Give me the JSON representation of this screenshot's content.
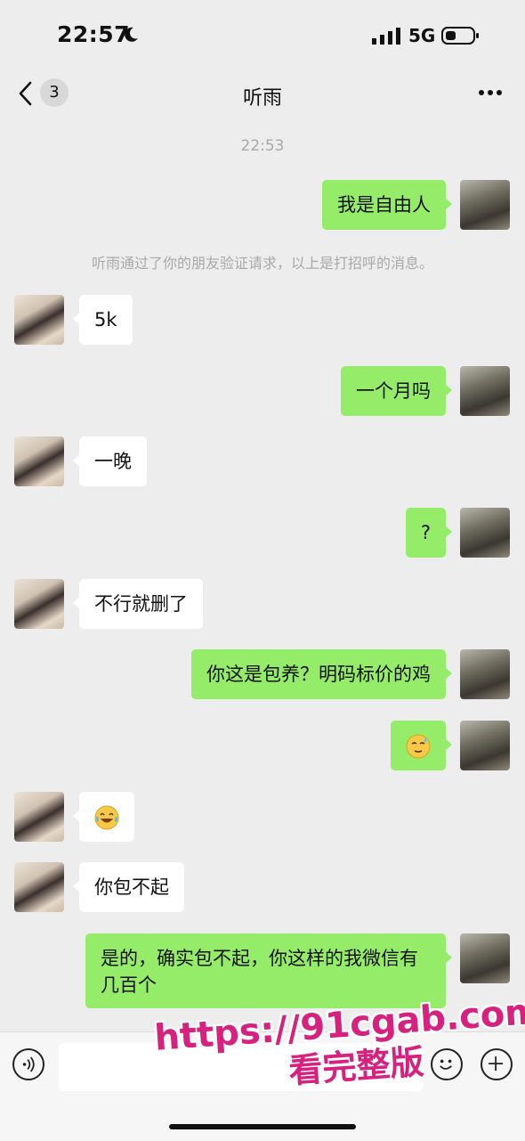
{
  "status_bar": {
    "time": "22:57",
    "network": "5G"
  },
  "header": {
    "back_badge": "3",
    "title": "听雨"
  },
  "timestamp": "22:53",
  "system_notice": "听雨通过了你的朋友验证请求，以上是打招呼的消息。",
  "messages": [
    {
      "from": "me",
      "text": "我是自由人"
    },
    {
      "from": "them",
      "text": "5k"
    },
    {
      "from": "me",
      "text": "一个月吗"
    },
    {
      "from": "them",
      "text": "一晚"
    },
    {
      "from": "me",
      "text": "?"
    },
    {
      "from": "them",
      "text": "不行就删了"
    },
    {
      "from": "me",
      "text": "你这是包养？明码标价的鸡"
    },
    {
      "from": "me",
      "emoji": "sweat-smile-emoji"
    },
    {
      "from": "them",
      "emoji": "tears-of-joy-emoji"
    },
    {
      "from": "them",
      "text": "你包不起"
    },
    {
      "from": "me",
      "text": "是的，确实包不起，你这样的我微信有几百个"
    }
  ],
  "input_bar": {
    "value": ""
  },
  "watermark": {
    "url": "https://91cgab.com",
    "text": "看完整版"
  },
  "colors": {
    "my_bubble": "#95ec69",
    "their_bubble": "#ffffff",
    "background": "#ededed",
    "watermark": "#d6217e"
  }
}
